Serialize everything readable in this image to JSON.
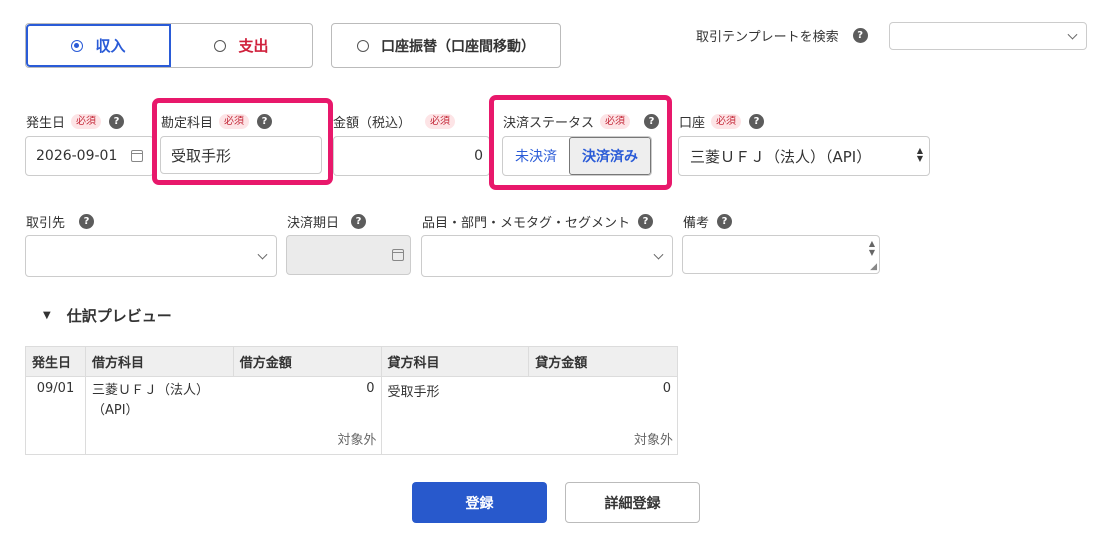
{
  "type_toggle": {
    "income": "収入",
    "expense": "支出",
    "transfer": "口座振替（口座間移動）"
  },
  "template_search": {
    "label": "取引テンプレートを検索",
    "value": ""
  },
  "required_badge": "必須",
  "help_glyph": "?",
  "fields": {
    "issue_date": {
      "label": "発生日",
      "value": "2026-09-01"
    },
    "account_item": {
      "label": "勘定科目",
      "value": "受取手形"
    },
    "amount": {
      "label": "金額（税込）",
      "value": "0"
    },
    "settlement_status": {
      "label": "決済ステータス",
      "unsettled": "未決済",
      "settled": "決済済み",
      "selected": "決済済み"
    },
    "wallet": {
      "label": "口座",
      "value": "三菱ＵＦＪ（法人）（API）"
    },
    "partner": {
      "label": "取引先",
      "value": ""
    },
    "due_date": {
      "label": "決済期日",
      "value": ""
    },
    "tags": {
      "label": "品目・部門・メモタグ・セグメント",
      "value": ""
    },
    "description": {
      "label": "備考",
      "value": ""
    }
  },
  "preview": {
    "title": "仕訳プレビュー",
    "headers": [
      "発生日",
      "借方科目",
      "借方金額",
      "貸方科目",
      "貸方金額"
    ],
    "row": {
      "date": "09/01",
      "debit_account": "三菱ＵＦＪ（法人）（API）",
      "debit_amount": "0",
      "debit_tax": "対象外",
      "credit_account": "受取手形",
      "credit_amount": "0",
      "credit_tax": "対象外"
    }
  },
  "buttons": {
    "register": "登録",
    "detail_register": "詳細登録"
  },
  "colors": {
    "primary": "#2859cc",
    "income": "#2a5bd7",
    "expense": "#d0213c",
    "highlight": "#e8186b"
  }
}
